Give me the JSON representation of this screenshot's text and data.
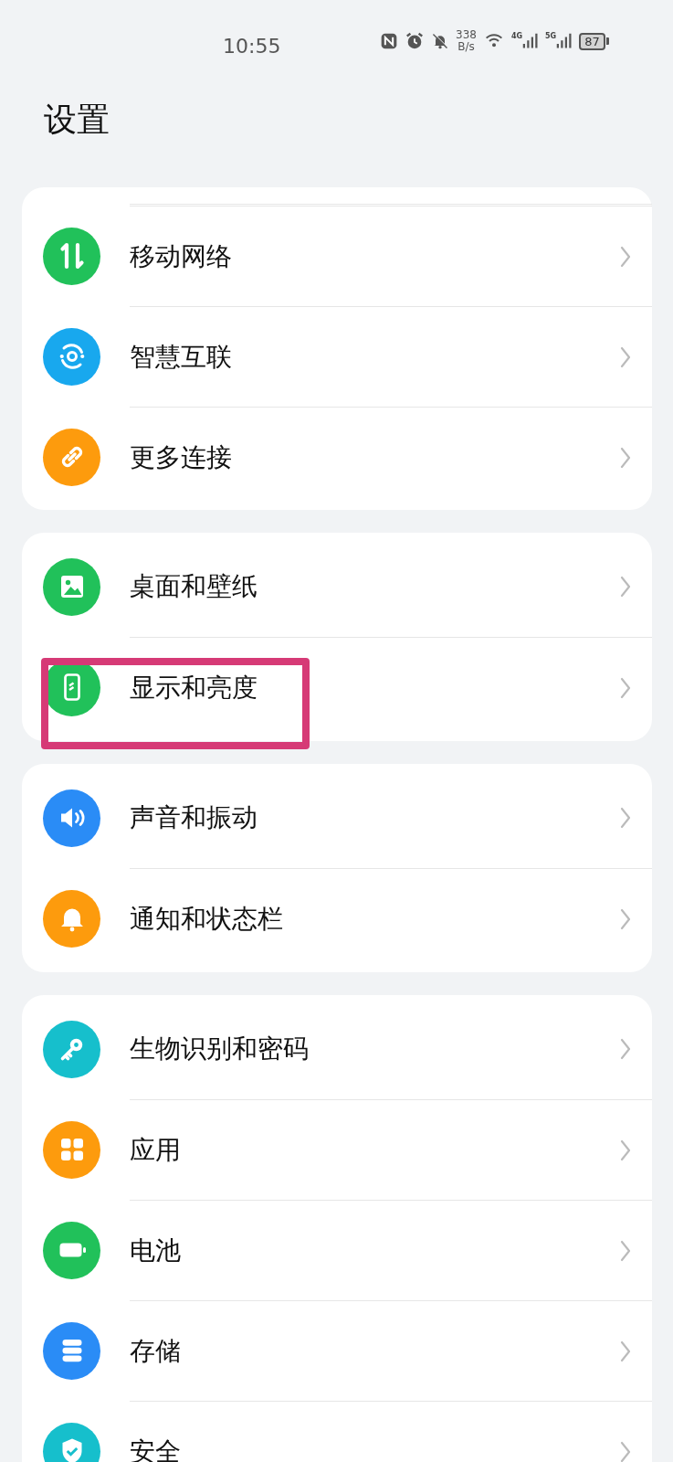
{
  "status_bar": {
    "time": "10:55",
    "speed_value": "338",
    "speed_unit": "B/s",
    "network_1": "4G",
    "network_2": "5G",
    "battery": "87"
  },
  "title": "设置",
  "groups": [
    {
      "top_divider": true,
      "items": [
        {
          "label": "移动网络",
          "color": "#21c15a"
        },
        {
          "label": "智慧互联",
          "color": "#18a8ee"
        },
        {
          "label": "更多连接",
          "color": "#fd9b0d"
        }
      ]
    },
    {
      "top_divider": false,
      "items": [
        {
          "label": "桌面和壁纸",
          "color": "#21c15a"
        },
        {
          "label": "显示和亮度",
          "color": "#21c15a",
          "highlighted": true
        }
      ]
    },
    {
      "top_divider": false,
      "items": [
        {
          "label": "声音和振动",
          "color": "#2a8cf6"
        },
        {
          "label": "通知和状态栏",
          "color": "#fd9b0d"
        }
      ]
    },
    {
      "top_divider": false,
      "items": [
        {
          "label": "生物识别和密码",
          "color": "#16bfcc"
        },
        {
          "label": "应用",
          "color": "#fd9b0d"
        },
        {
          "label": "电池",
          "color": "#21c15a"
        },
        {
          "label": "存储",
          "color": "#2a8cf6"
        },
        {
          "label": "安全",
          "color": "#16bfcc"
        }
      ]
    }
  ]
}
